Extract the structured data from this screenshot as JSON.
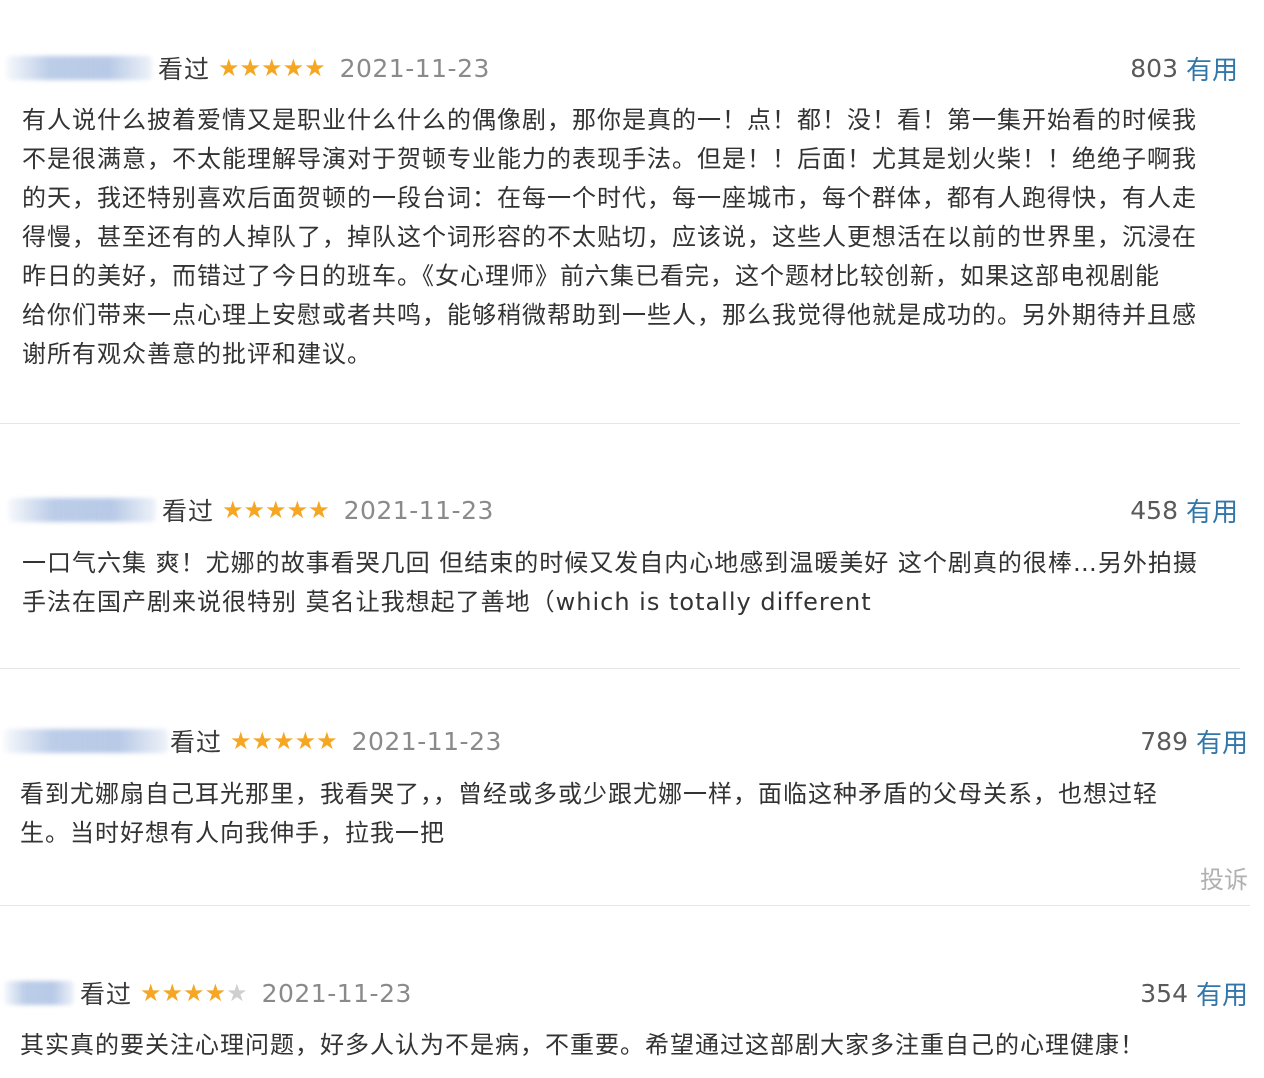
{
  "reviews": [
    {
      "status": "看过",
      "rating": 5,
      "date": "2021-11-23",
      "votes": "803",
      "useful_label": "有用",
      "lines": [
        "有人说什么披着爱情又是职业什么什么的偶像剧，那你是真的一！点！都！没！看！第一集开始看的时候我",
        "不是很满意，不太能理解导演对于贺顿专业能力的表现手法。但是！！后面！尤其是划火柴！！绝绝子啊我",
        "的天，我还特别喜欢后面贺顿的一段台词：在每一个时代，每一座城市，每个群体，都有人跑得快，有人走",
        "得慢，甚至还有的人掉队了，掉队这个词形容的不太贴切，应该说，这些人更想活在以前的世界里，沉浸在",
        "昨日的美好，而错过了今日的班车。《女心理师》前六集已看完，这个题材比较创新，如果这部电视剧能",
        "给你们带来一点心理上安慰或者共鸣，能够稍微帮助到一些人，那么我觉得他就是成功的。另外期待并且感",
        "谢所有观众善意的批评和建议。"
      ]
    },
    {
      "status": "看过",
      "rating": 5,
      "date": "2021-11-23",
      "votes": "458",
      "useful_label": "有用",
      "lines": [
        "一口气六集 爽！尤娜的故事看哭几回 但结束的时候又发自内心地感到温暖美好 这个剧真的很棒…另外拍摄",
        "手法在国产剧来说很特别 莫名让我想起了善地（which is totally different"
      ]
    },
    {
      "status": "看过",
      "rating": 5,
      "date": "2021-11-23",
      "votes": "789",
      "useful_label": "有用",
      "lines": [
        "看到尤娜扇自己耳光那里，我看哭了，，曾经或多或少跟尤娜一样，面临这种矛盾的父母关系，也想过轻",
        "生。当时好想有人向我伸手，拉我一把"
      ],
      "report_label": "投诉"
    },
    {
      "status": "看过",
      "rating": 4,
      "date": "2021-11-23",
      "votes": "354",
      "useful_label": "有用",
      "lines": [
        "其实真的要关注心理问题，好多人认为不是病，不重要。希望通过这部剧大家多注重自己的心理健康！"
      ]
    }
  ],
  "colors": {
    "star_on": "#f5a623",
    "star_off": "#cfcfcf",
    "useful_link": "#3377aa",
    "body_text": "#333333",
    "date_text": "#8a8a8a"
  },
  "icons": {
    "rating": "star-icon",
    "avatar": "blurred-username"
  }
}
